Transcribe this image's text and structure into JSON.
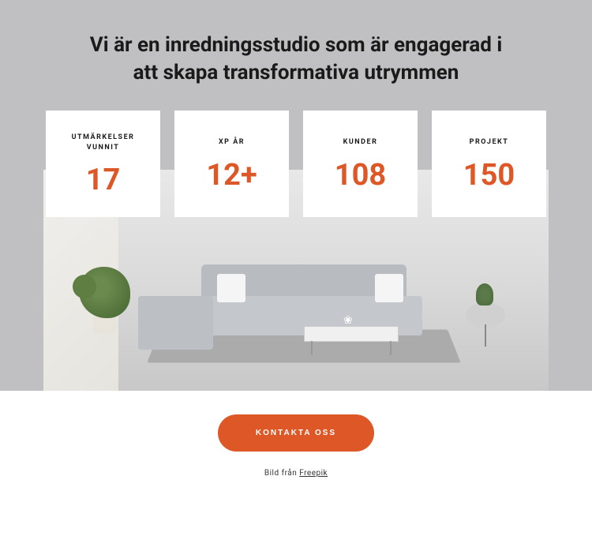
{
  "hero": {
    "title": "Vi är en inredningsstudio som är engagerad i att skapa transformativa utrymmen"
  },
  "stats": [
    {
      "label": "UTMÄRKELSER VUNNIT",
      "value": "17"
    },
    {
      "label": "XP ÅR",
      "value": "12+"
    },
    {
      "label": "KUNDER",
      "value": "108"
    },
    {
      "label": "PROJEKT",
      "value": "150"
    }
  ],
  "cta": {
    "label": "KONTAKTA OSS"
  },
  "attribution": {
    "prefix": "Bild från ",
    "link": "Freepik"
  },
  "colors": {
    "accent": "#de5726",
    "heroBg": "#c0c0c3"
  }
}
